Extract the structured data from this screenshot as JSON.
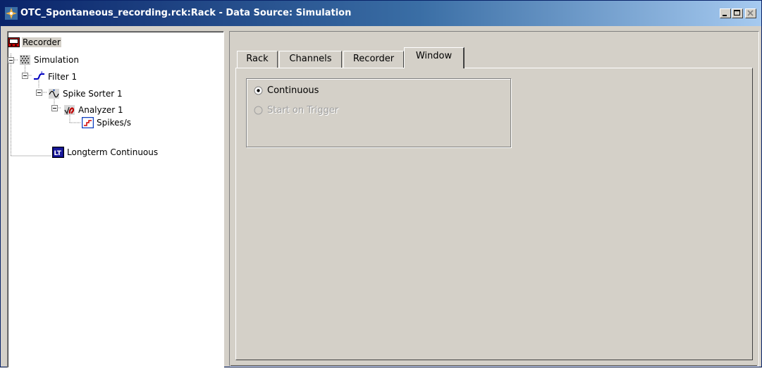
{
  "window": {
    "title": "OTC_Spontaneous_recording.rck:Rack - Data Source: Simulation",
    "controls": [
      "minimize",
      "maximize",
      "close"
    ]
  },
  "tree": {
    "items": [
      {
        "label": "Recorder",
        "icon": "recorder-icon",
        "selected": true
      },
      {
        "label": "Simulation",
        "icon": "simulation-icon"
      },
      {
        "label": "Filter 1",
        "icon": "filter-icon"
      },
      {
        "label": "Spike Sorter 1",
        "icon": "spike-sorter-icon"
      },
      {
        "label": "Analyzer 1",
        "icon": "analyzer-icon"
      },
      {
        "label": "Spikes/s",
        "icon": "spikes-chart-icon"
      },
      {
        "label": "Longterm Continuous",
        "icon": "longterm-icon",
        "icon_text": "LT"
      }
    ]
  },
  "tabs": [
    {
      "label": "Rack"
    },
    {
      "label": "Channels"
    },
    {
      "label": "Recorder"
    },
    {
      "label": "Window",
      "active": true
    }
  ],
  "window_tab": {
    "options": [
      {
        "label": "Continuous",
        "selected": true,
        "enabled": true
      },
      {
        "label": "Start on Trigger",
        "selected": false,
        "enabled": false
      }
    ]
  },
  "colors": {
    "titlebar_start": "#0a246a",
    "titlebar_end": "#a6caf0",
    "face": "#d4d0c8"
  }
}
